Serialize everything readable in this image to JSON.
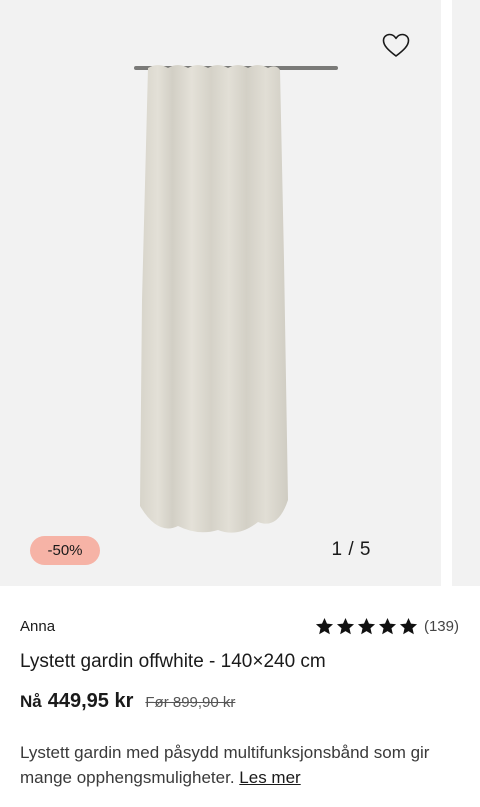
{
  "gallery": {
    "pager": "1 / 5",
    "discount": "-50%",
    "favorite_icon": "heart-outline-icon"
  },
  "product": {
    "brand": "Anna",
    "title": "Lystett gardin offwhite - 140×240 cm",
    "rating": {
      "stars": 5,
      "count": "(139)"
    },
    "price": {
      "prefix": "Nå",
      "current": "449,95 kr",
      "old": "Før 899,90 kr"
    },
    "description": "Lystett gardin med påsydd multifunksjonsbånd som gir mange opphengsmuligheter.",
    "read_more": "Les mer"
  },
  "colors": {
    "badge": "#f6b3a6",
    "curtain": "#dedbd1",
    "background": "#f2f2f2"
  }
}
